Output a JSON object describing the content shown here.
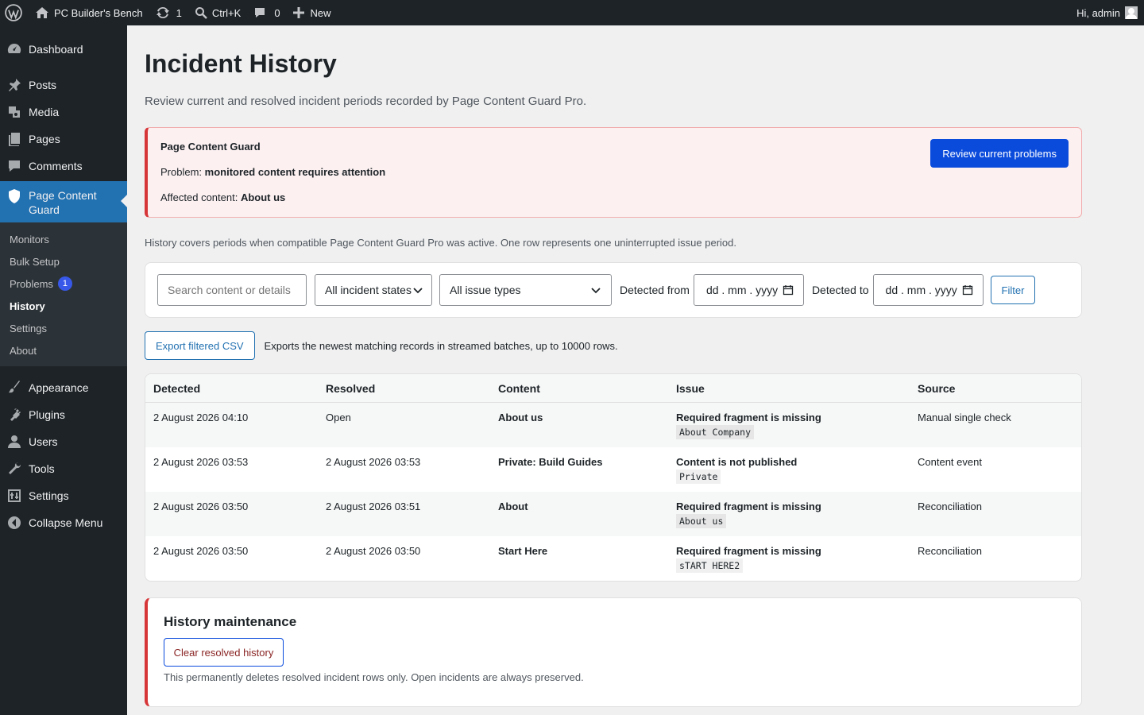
{
  "admin_bar": {
    "site_name": "PC Builder's Bench",
    "updates_count": "1",
    "search_shortcut": "Ctrl+K",
    "comments_count": "0",
    "new_label": "New",
    "greeting": "Hi, admin"
  },
  "sidebar": {
    "dashboard": "Dashboard",
    "posts": "Posts",
    "media": "Media",
    "pages": "Pages",
    "comments": "Comments",
    "plugin": "Page Content Guard",
    "submenu": {
      "monitors": "Monitors",
      "bulk_setup": "Bulk Setup",
      "problems": "Problems",
      "problems_count": "1",
      "history": "History",
      "settings": "Settings",
      "about": "About"
    },
    "appearance": "Appearance",
    "plugins": "Plugins",
    "users": "Users",
    "tools": "Tools",
    "settings": "Settings",
    "collapse": "Collapse Menu"
  },
  "page": {
    "title": "Incident History",
    "subtitle": "Review current and resolved incident periods recorded by Page Content Guard Pro."
  },
  "notice": {
    "title": "Page Content Guard",
    "problem_label": "Problem:",
    "problem_value": "monitored content requires attention",
    "affected_label": "Affected content:",
    "affected_value": "About us",
    "button": "Review current problems"
  },
  "history_note": "History covers periods when compatible Page Content Guard Pro was active. One row represents one uninterrupted issue period.",
  "filters": {
    "search_placeholder": "Search content or details",
    "state_select": "All incident states",
    "type_select": "All issue types",
    "from_label": "Detected from",
    "from_value": "dd . mm . yyyy",
    "to_label": "Detected to",
    "to_value": "dd . mm . yyyy",
    "filter_button": "Filter"
  },
  "export": {
    "button": "Export filtered CSV",
    "note": "Exports the newest matching records in streamed batches, up to 10000 rows."
  },
  "table": {
    "headers": [
      "Detected",
      "Resolved",
      "Content",
      "Issue",
      "Source"
    ],
    "rows": [
      {
        "detected": "2 August 2026 04:10",
        "resolved": "Open",
        "content": "About us",
        "issue": "Required fragment is missing",
        "detail": "About Company",
        "source": "Manual single check"
      },
      {
        "detected": "2 August 2026 03:53",
        "resolved": "2 August 2026 03:53",
        "content": "Private: Build Guides",
        "issue": "Content is not published",
        "detail": "Private",
        "source": "Content event"
      },
      {
        "detected": "2 August 2026 03:50",
        "resolved": "2 August 2026 03:51",
        "content": "About",
        "issue": "Required fragment is missing",
        "detail": "About us",
        "source": "Reconciliation"
      },
      {
        "detected": "2 August 2026 03:50",
        "resolved": "2 August 2026 03:50",
        "content": "Start Here",
        "issue": "Required fragment is missing",
        "detail": "sTART HERE2",
        "source": "Reconciliation"
      }
    ]
  },
  "maintenance": {
    "title": "History maintenance",
    "button": "Clear resolved history",
    "note": "This permanently deletes resolved incident rows only. Open incidents are always preserved."
  }
}
